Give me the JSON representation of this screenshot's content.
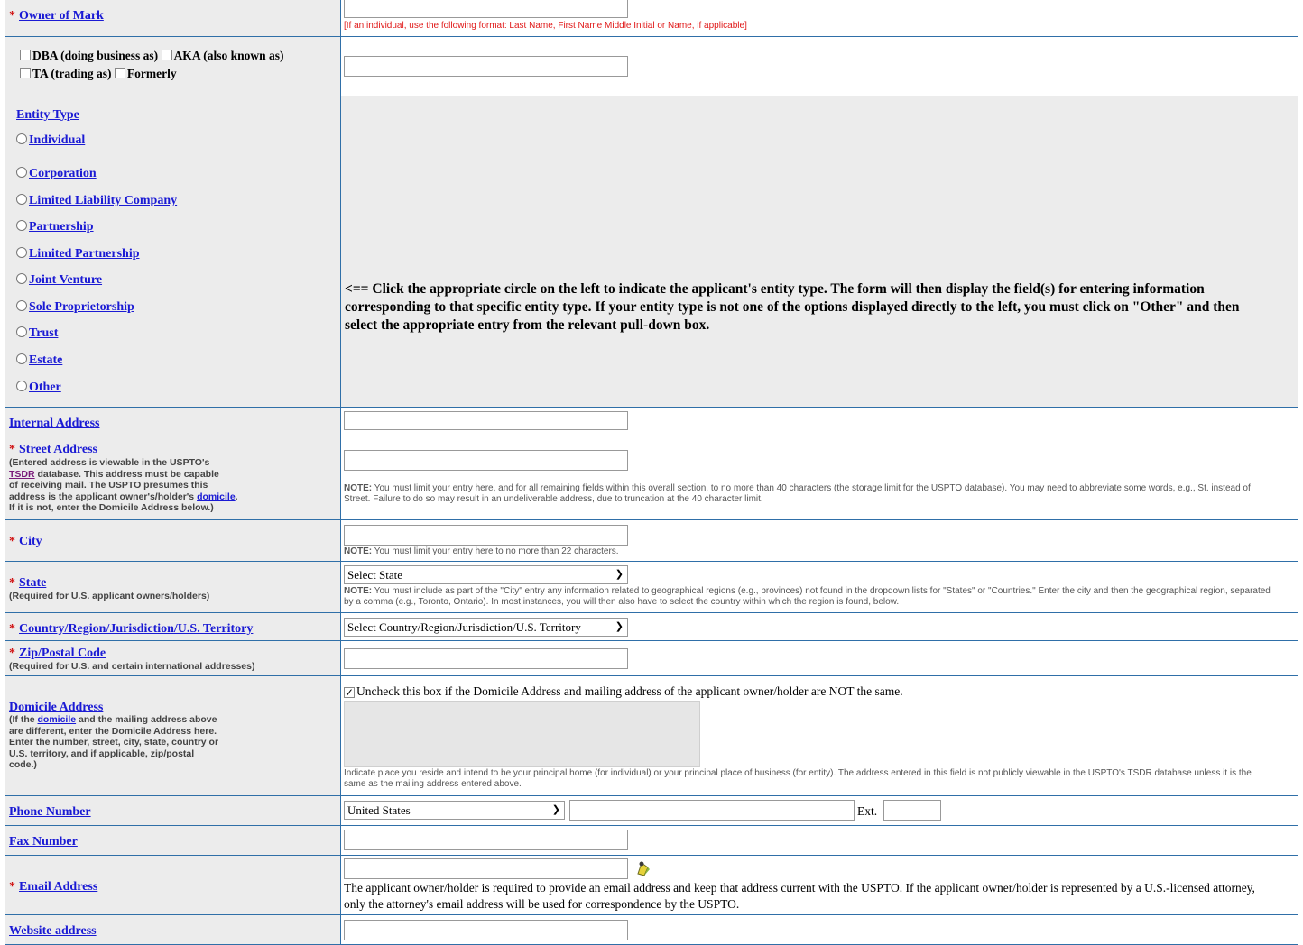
{
  "owner": {
    "label": "Owner of Mark",
    "note": "[If an individual, use the following format: Last Name, First Name Middle Initial or Name, if applicable]"
  },
  "dba": {
    "dba_label": "DBA (doing business as)",
    "aka_label": "AKA (also known as)",
    "ta_label": "TA (trading as)",
    "formerly_label": "Formerly"
  },
  "entity": {
    "heading": "Entity Type",
    "options": [
      "Individual",
      "Corporation",
      "Limited Liability Company",
      "Partnership",
      "Limited Partnership",
      "Joint Venture",
      "Sole Proprietorship",
      "Trust",
      "Estate",
      "Other"
    ],
    "instruction": "<== Click the appropriate circle on the left to indicate the applicant's entity type. The form will then display the field(s) for entering information corresponding to that specific entity type. If your entity type is not one of the options displayed directly to the left, you must click on \"Other\" and then select the appropriate entry from the relevant pull-down box."
  },
  "internal_address": {
    "label": "Internal Address"
  },
  "street": {
    "label": "Street Address",
    "help_1": "(Entered address is viewable in the USPTO's",
    "tsdr": "TSDR",
    "help_2": "database. This address must be capable",
    "help_3": "of receiving mail. The USPTO presumes this",
    "help_4": "address is the applicant owner's/holder's",
    "domicile_link": "domicile",
    "help_5": ".",
    "help_6": "If it is not, enter the Domicile Address below.)",
    "note_bold": "NOTE:",
    "note": " You must limit your entry here, and for all remaining fields within this overall section, to no more than 40 characters (the storage limit for the USPTO database). You may need to abbreviate some words, e.g., St. instead of Street. Failure to do so may result in an undeliverable address, due to truncation at the 40 character limit."
  },
  "city": {
    "label": "City",
    "note_bold": "NOTE:",
    "note": " You must limit your entry here to no more than 22 characters."
  },
  "state": {
    "label": "State",
    "help": "(Required for U.S. applicant owners/holders)",
    "selected": "Select State",
    "note_bold": "NOTE:",
    "note": " You must include as part of the \"City\" entry any information related to geographical regions (e.g., provinces) not found in the dropdown lists for \"States\" or \"Countries.\" Enter the city and then the geographical region, separated by a comma (e.g., Toronto, Ontario). In most instances, you will then also have to select the country within which the region is found, below."
  },
  "country": {
    "label": "Country/Region/Jurisdiction/U.S. Territory",
    "selected": "Select Country/Region/Jurisdiction/U.S. Territory"
  },
  "zip": {
    "label": "Zip/Postal Code",
    "help": "(Required for U.S. and certain international addresses)"
  },
  "domicile": {
    "label": "Domicile Address",
    "help_1": "(If the",
    "help_link": "domicile",
    "help_2": "and the mailing address above",
    "help_3": "are different, enter the Domicile Address here.",
    "help_4": "Enter the number, street, city, state, country or",
    "help_5": "U.S. territory, and if applicable, zip/postal",
    "help_6": "code.)",
    "checkbox_label": "Uncheck this box if the Domicile Address and mailing address of the applicant owner/holder are NOT the same.",
    "note": "Indicate place you reside and intend to be your principal home (for individual) or your principal place of business (for entity). The address entered in this field is not publicly viewable in the USPTO's TSDR database unless it is the same as the mailing address entered above."
  },
  "phone": {
    "label": "Phone Number",
    "country": "United States",
    "ext_label": "Ext."
  },
  "fax": {
    "label": "Fax Number"
  },
  "email": {
    "label": "Email Address",
    "note": "The applicant owner/holder is required to provide an email address and keep that address current with the USPTO. If the applicant owner/holder is represented by a U.S.-licensed attorney, only the attorney's email address will be used for correspondence by the USPTO."
  },
  "website": {
    "label": "Website address"
  },
  "colors": {
    "link": "#1a1ad4",
    "required": "#d01010",
    "border": "#2f6fa8",
    "cell_bg": "#ececec"
  }
}
